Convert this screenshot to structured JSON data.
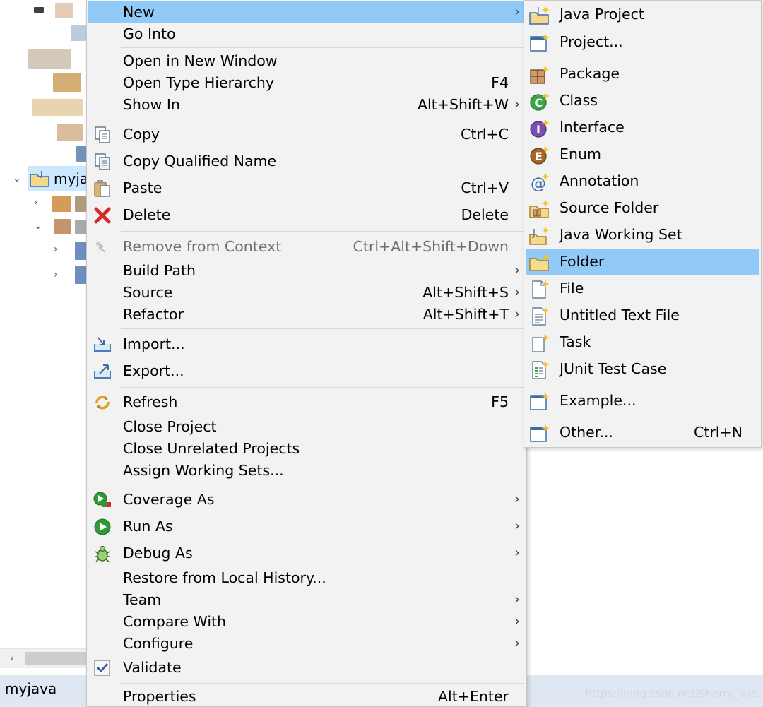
{
  "explorer": {
    "project_label": "myja",
    "status_label": "myjava"
  },
  "watermark": "https://blog.csdn.net/Sherry_Yue",
  "context_menu": {
    "items": [
      {
        "label": "New",
        "shortcut": "",
        "submenu": true,
        "icon": "",
        "highlighted": true
      },
      {
        "label": "Go Into",
        "shortcut": "",
        "submenu": false,
        "icon": ""
      },
      {
        "label": "Open in New Window",
        "shortcut": "",
        "submenu": false,
        "icon": ""
      },
      {
        "label": "Open Type Hierarchy",
        "shortcut": "F4",
        "submenu": false,
        "icon": ""
      },
      {
        "label": "Show In",
        "shortcut": "Alt+Shift+W",
        "submenu": true,
        "icon": ""
      },
      {
        "label": "Copy",
        "shortcut": "Ctrl+C",
        "submenu": false,
        "icon": "copy-icon"
      },
      {
        "label": "Copy Qualified Name",
        "shortcut": "",
        "submenu": false,
        "icon": "copy-qualified-name-icon"
      },
      {
        "label": "Paste",
        "shortcut": "Ctrl+V",
        "submenu": false,
        "icon": "paste-icon"
      },
      {
        "label": "Delete",
        "shortcut": "Delete",
        "submenu": false,
        "icon": "delete-icon"
      },
      {
        "label": "Remove from Context",
        "shortcut": "Ctrl+Alt+Shift+Down",
        "submenu": false,
        "icon": "remove-context-icon",
        "disabled": true
      },
      {
        "label": "Build Path",
        "shortcut": "",
        "submenu": true,
        "icon": ""
      },
      {
        "label": "Source",
        "shortcut": "Alt+Shift+S",
        "submenu": true,
        "icon": ""
      },
      {
        "label": "Refactor",
        "shortcut": "Alt+Shift+T",
        "submenu": true,
        "icon": ""
      },
      {
        "label": "Import...",
        "shortcut": "",
        "submenu": false,
        "icon": "import-icon"
      },
      {
        "label": "Export...",
        "shortcut": "",
        "submenu": false,
        "icon": "export-icon"
      },
      {
        "label": "Refresh",
        "shortcut": "F5",
        "submenu": false,
        "icon": "refresh-icon"
      },
      {
        "label": "Close Project",
        "shortcut": "",
        "submenu": false,
        "icon": ""
      },
      {
        "label": "Close Unrelated Projects",
        "shortcut": "",
        "submenu": false,
        "icon": ""
      },
      {
        "label": "Assign Working Sets...",
        "shortcut": "",
        "submenu": false,
        "icon": ""
      },
      {
        "label": "Coverage As",
        "shortcut": "",
        "submenu": true,
        "icon": "coverage-icon"
      },
      {
        "label": "Run As",
        "shortcut": "",
        "submenu": true,
        "icon": "run-icon"
      },
      {
        "label": "Debug As",
        "shortcut": "",
        "submenu": true,
        "icon": "debug-bug-icon"
      },
      {
        "label": "Restore from Local History...",
        "shortcut": "",
        "submenu": false,
        "icon": ""
      },
      {
        "label": "Team",
        "shortcut": "",
        "submenu": true,
        "icon": ""
      },
      {
        "label": "Compare With",
        "shortcut": "",
        "submenu": true,
        "icon": ""
      },
      {
        "label": "Configure",
        "shortcut": "",
        "submenu": true,
        "icon": ""
      },
      {
        "label": "Validate",
        "shortcut": "",
        "submenu": false,
        "icon": "validate-check-icon"
      },
      {
        "label": "Properties",
        "shortcut": "Alt+Enter",
        "submenu": false,
        "icon": ""
      }
    ]
  },
  "new_submenu": {
    "items": [
      {
        "label": "Java Project",
        "shortcut": "",
        "icon": "java-project-icon"
      },
      {
        "label": "Project...",
        "shortcut": "",
        "icon": "project-icon"
      },
      {
        "label": "Package",
        "shortcut": "",
        "icon": "package-icon"
      },
      {
        "label": "Class",
        "shortcut": "",
        "icon": "class-icon"
      },
      {
        "label": "Interface",
        "shortcut": "",
        "icon": "interface-icon"
      },
      {
        "label": "Enum",
        "shortcut": "",
        "icon": "enum-icon"
      },
      {
        "label": "Annotation",
        "shortcut": "",
        "icon": "annotation-icon"
      },
      {
        "label": "Source Folder",
        "shortcut": "",
        "icon": "source-folder-icon"
      },
      {
        "label": "Java Working Set",
        "shortcut": "",
        "icon": "java-working-set-icon"
      },
      {
        "label": "Folder",
        "shortcut": "",
        "icon": "folder-icon",
        "highlighted": true
      },
      {
        "label": "File",
        "shortcut": "",
        "icon": "file-icon"
      },
      {
        "label": "Untitled Text File",
        "shortcut": "",
        "icon": "text-file-icon"
      },
      {
        "label": "Task",
        "shortcut": "",
        "icon": "task-icon"
      },
      {
        "label": "JUnit Test Case",
        "shortcut": "",
        "icon": "junit-icon"
      },
      {
        "label": "Example...",
        "shortcut": "",
        "icon": "example-icon"
      },
      {
        "label": "Other...",
        "shortcut": "Ctrl+N",
        "icon": "other-icon"
      }
    ]
  },
  "colors": {
    "menu_bg": "#f2f2f2",
    "highlight": "#91c9f7",
    "selection": "#cce8ff",
    "disabled_text": "#6d6d6d"
  }
}
